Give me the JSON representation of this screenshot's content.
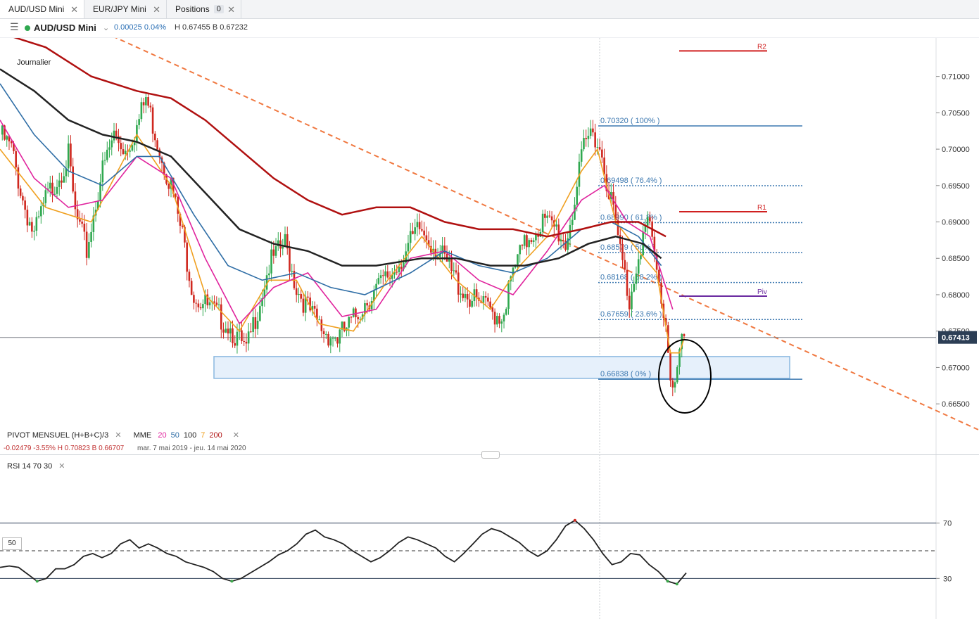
{
  "tabs": [
    {
      "label": "AUD/USD Mini",
      "active": true
    },
    {
      "label": "EUR/JPY Mini"
    },
    {
      "label": "Positions",
      "badge": "0"
    }
  ],
  "header": {
    "symbol": "AUD/USD Mini",
    "change": "0.00025  0.04%",
    "high_low": "H 0.67455  B 0.67232"
  },
  "chart_label": "Journalier",
  "indicators": {
    "pivot": "PIVOT  MENSUEL  (H+B+C)/3",
    "mme": "MME",
    "mme_periods": [
      {
        "v": "20",
        "color": "#e0239d"
      },
      {
        "v": "50",
        "color": "#2f6ea6"
      },
      {
        "v": "100",
        "color": "#222222"
      },
      {
        "v": "7",
        "color": "#f0a020"
      },
      {
        "v": "200",
        "color": "#b01010"
      }
    ],
    "stats": "-0.02479   -3.55%    H 0.70823    B 0.66707",
    "range": "mar. 7 mai 2019 - jeu. 14 mai 2020",
    "rsi": "RSI  14  70  30",
    "rsi_mid_label": "50"
  },
  "chart_data": {
    "type": "candlestick",
    "title": "AUD/USD Mini",
    "timeframe": "Journalier",
    "ylim": [
      0.6625,
      0.7147
    ],
    "y_ticks": [
      0.655,
      0.665,
      0.67,
      0.675,
      0.68,
      0.685,
      0.69,
      0.695,
      0.7,
      0.705,
      0.71
    ],
    "y_tick_labels": [
      "",
      "0.66500",
      "0.67000",
      "0.67500",
      "0.68000",
      "0.68500",
      "0.69000",
      "0.69500",
      "0.70000",
      "0.70500",
      "0.71000"
    ],
    "last_price": "0.67413",
    "date_range": "mar. 7 mai 2019 - jeu. 14 mai 2020",
    "close_path": [
      [
        0,
        0.702
      ],
      [
        5,
        0.7
      ],
      [
        10,
        0.693
      ],
      [
        15,
        0.688
      ],
      [
        20,
        0.693
      ],
      [
        25,
        0.696
      ],
      [
        30,
        0.699
      ],
      [
        33,
        0.691
      ],
      [
        38,
        0.686
      ],
      [
        44,
        0.696
      ],
      [
        50,
        0.702
      ],
      [
        55,
        0.7
      ],
      [
        60,
        0.703
      ],
      [
        64,
        0.707
      ],
      [
        70,
        0.7
      ],
      [
        75,
        0.695
      ],
      [
        80,
        0.688
      ],
      [
        85,
        0.68
      ],
      [
        92,
        0.678
      ],
      [
        100,
        0.676
      ],
      [
        108,
        0.672
      ],
      [
        112,
        0.677
      ],
      [
        118,
        0.684
      ],
      [
        125,
        0.687
      ],
      [
        130,
        0.681
      ],
      [
        137,
        0.677
      ],
      [
        142,
        0.675
      ],
      [
        148,
        0.674
      ],
      [
        154,
        0.676
      ],
      [
        160,
        0.679
      ],
      [
        166,
        0.681
      ],
      [
        172,
        0.683
      ],
      [
        178,
        0.686
      ],
      [
        184,
        0.689
      ],
      [
        190,
        0.687
      ],
      [
        196,
        0.684
      ],
      [
        202,
        0.681
      ],
      [
        208,
        0.679
      ],
      [
        214,
        0.678
      ],
      [
        220,
        0.677
      ],
      [
        226,
        0.684
      ],
      [
        232,
        0.688
      ],
      [
        238,
        0.69
      ],
      [
        244,
        0.689
      ],
      [
        248,
        0.687
      ],
      [
        252,
        0.693
      ],
      [
        256,
        0.7
      ],
      [
        260,
        0.703
      ],
      [
        264,
        0.699
      ],
      [
        268,
        0.693
      ],
      [
        272,
        0.686
      ],
      [
        276,
        0.679
      ],
      [
        280,
        0.686
      ],
      [
        284,
        0.69
      ],
      [
        286,
        0.687
      ],
      [
        289,
        0.681
      ],
      [
        292,
        0.676
      ],
      [
        294,
        0.669
      ],
      [
        296,
        0.668
      ],
      [
        298,
        0.672
      ],
      [
        300,
        0.674
      ]
    ],
    "ema": [
      {
        "period": 7,
        "color": "#f0a020",
        "points": [
          [
            0,
            0.7
          ],
          [
            20,
            0.692
          ],
          [
            40,
            0.69
          ],
          [
            60,
            0.702
          ],
          [
            75,
            0.695
          ],
          [
            90,
            0.68
          ],
          [
            105,
            0.675
          ],
          [
            118,
            0.682
          ],
          [
            130,
            0.682
          ],
          [
            140,
            0.676
          ],
          [
            155,
            0.675
          ],
          [
            170,
            0.682
          ],
          [
            185,
            0.688
          ],
          [
            200,
            0.682
          ],
          [
            215,
            0.678
          ],
          [
            228,
            0.684
          ],
          [
            240,
            0.688
          ],
          [
            255,
            0.697
          ],
          [
            262,
            0.7
          ],
          [
            270,
            0.69
          ],
          [
            280,
            0.686
          ],
          [
            288,
            0.683
          ],
          [
            294,
            0.672
          ],
          [
            298,
            0.672
          ],
          [
            300,
            0.674
          ]
        ]
      },
      {
        "period": 20,
        "color": "#e0239d",
        "points": [
          [
            0,
            0.704
          ],
          [
            15,
            0.696
          ],
          [
            30,
            0.692
          ],
          [
            45,
            0.693
          ],
          [
            60,
            0.699
          ],
          [
            75,
            0.696
          ],
          [
            90,
            0.685
          ],
          [
            105,
            0.676
          ],
          [
            120,
            0.681
          ],
          [
            135,
            0.683
          ],
          [
            150,
            0.677
          ],
          [
            165,
            0.678
          ],
          [
            180,
            0.685
          ],
          [
            195,
            0.686
          ],
          [
            210,
            0.682
          ],
          [
            225,
            0.68
          ],
          [
            240,
            0.686
          ],
          [
            255,
            0.693
          ],
          [
            265,
            0.695
          ],
          [
            275,
            0.69
          ],
          [
            285,
            0.688
          ],
          [
            295,
            0.678
          ]
        ]
      },
      {
        "period": 50,
        "color": "#2f6ea6",
        "points": [
          [
            0,
            0.709
          ],
          [
            15,
            0.702
          ],
          [
            30,
            0.697
          ],
          [
            45,
            0.695
          ],
          [
            60,
            0.699
          ],
          [
            70,
            0.699
          ],
          [
            85,
            0.691
          ],
          [
            100,
            0.684
          ],
          [
            115,
            0.682
          ],
          [
            130,
            0.683
          ],
          [
            145,
            0.681
          ],
          [
            160,
            0.68
          ],
          [
            180,
            0.683
          ],
          [
            195,
            0.686
          ],
          [
            210,
            0.684
          ],
          [
            225,
            0.683
          ],
          [
            240,
            0.685
          ],
          [
            255,
            0.689
          ],
          [
            268,
            0.69
          ],
          [
            280,
            0.688
          ],
          [
            290,
            0.684
          ]
        ]
      },
      {
        "period": 100,
        "color": "#222222",
        "points": [
          [
            0,
            0.711
          ],
          [
            15,
            0.708
          ],
          [
            30,
            0.704
          ],
          [
            45,
            0.702
          ],
          [
            60,
            0.701
          ],
          [
            75,
            0.699
          ],
          [
            90,
            0.694
          ],
          [
            105,
            0.689
          ],
          [
            120,
            0.687
          ],
          [
            135,
            0.686
          ],
          [
            150,
            0.684
          ],
          [
            165,
            0.684
          ],
          [
            185,
            0.685
          ],
          [
            200,
            0.685
          ],
          [
            215,
            0.684
          ],
          [
            230,
            0.684
          ],
          [
            245,
            0.685
          ],
          [
            258,
            0.687
          ],
          [
            270,
            0.688
          ],
          [
            282,
            0.687
          ],
          [
            290,
            0.685
          ]
        ]
      },
      {
        "period": 200,
        "color": "#b01010",
        "points": [
          [
            0,
            0.716
          ],
          [
            20,
            0.714
          ],
          [
            40,
            0.71
          ],
          [
            60,
            0.708
          ],
          [
            75,
            0.707
          ],
          [
            90,
            0.704
          ],
          [
            105,
            0.7
          ],
          [
            120,
            0.696
          ],
          [
            135,
            0.693
          ],
          [
            150,
            0.691
          ],
          [
            165,
            0.692
          ],
          [
            180,
            0.692
          ],
          [
            195,
            0.69
          ],
          [
            210,
            0.689
          ],
          [
            225,
            0.689
          ],
          [
            240,
            0.688
          ],
          [
            255,
            0.689
          ],
          [
            268,
            0.69
          ],
          [
            280,
            0.69
          ],
          [
            292,
            0.688
          ]
        ]
      }
    ],
    "fibonacci": [
      {
        "label": "0.70320 ( 100% )",
        "price": 0.7032,
        "style": "solid"
      },
      {
        "label": "0.69498 ( 76.4% )",
        "price": 0.69498,
        "style": "dotted"
      },
      {
        "label": "0.68990 ( 61.8% )",
        "price": 0.6899,
        "style": "dotted"
      },
      {
        "label": "0.68579 ( 50% )",
        "price": 0.68579,
        "style": "dotted"
      },
      {
        "label": "0.68168 ( 38.2% )",
        "price": 0.68168,
        "style": "dotted"
      },
      {
        "label": "0.67659 ( 23.6% )",
        "price": 0.67659,
        "style": "dotted"
      },
      {
        "label": "0.66838 ( 0% )",
        "price": 0.66838,
        "style": "solid"
      }
    ],
    "pivots": [
      {
        "label": "R2",
        "price": 0.7135,
        "color": "#d02020"
      },
      {
        "label": "R1",
        "price": 0.6914,
        "color": "#d02020"
      },
      {
        "label": "Piv",
        "price": 0.6798,
        "color": "#6a2aa0"
      }
    ],
    "support_zone": [
      0.6685,
      0.6715
    ],
    "trendline": {
      "from": [
        0,
        0.7208
      ],
      "to": [
        320,
        0.6614
      ],
      "color": "#f07840",
      "style": "dashed"
    },
    "rsi": {
      "levels": [
        70,
        50,
        30
      ],
      "level_labels": [
        "70",
        "50",
        "30"
      ],
      "values": [
        38,
        39,
        38,
        33,
        28,
        30,
        37,
        37,
        40,
        46,
        48,
        45,
        48,
        55,
        58,
        52,
        55,
        52,
        48,
        46,
        42,
        40,
        38,
        35,
        30,
        28,
        30,
        34,
        38,
        42,
        47,
        50,
        55,
        62,
        65,
        60,
        58,
        55,
        50,
        46,
        42,
        45,
        50,
        56,
        60,
        58,
        55,
        52,
        46,
        42,
        48,
        55,
        62,
        66,
        64,
        60,
        56,
        50,
        46,
        50,
        58,
        68,
        72,
        66,
        58,
        48,
        40,
        42,
        48,
        47,
        40,
        35,
        28,
        26,
        34
      ]
    }
  }
}
